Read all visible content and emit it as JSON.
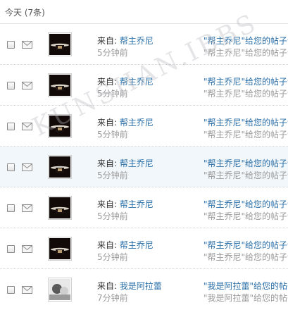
{
  "header": {
    "title": "今天 (7条)"
  },
  "messages": [
    {
      "from_prefix": "来自: ",
      "from_name": "帮主乔尼",
      "time": "5分钟前",
      "subject": "\"帮主乔尼\"给您的帖子评",
      "subject_sub": "\"帮主乔尼\"给您的帖子评"
    },
    {
      "from_prefix": "来自: ",
      "from_name": "帮主乔尼",
      "time": "5分钟前",
      "subject": "\"帮主乔尼\"给您的帖子评",
      "subject_sub": "\"帮主乔尼\"给您的帖子评"
    },
    {
      "from_prefix": "来自: ",
      "from_name": "帮主乔尼",
      "time": "5分钟前",
      "subject": "\"帮主乔尼\"给您的帖子评",
      "subject_sub": "\"帮主乔尼\"给您的帖子评"
    },
    {
      "from_prefix": "来自: ",
      "from_name": "帮主乔尼",
      "time": "5分钟前",
      "subject": "\"帮主乔尼\"给您的帖子评",
      "subject_sub": "\"帮主乔尼\"给您的帖子评"
    },
    {
      "from_prefix": "来自: ",
      "from_name": "帮主乔尼",
      "time": "5分钟前",
      "subject": "\"帮主乔尼\"给您的帖子评",
      "subject_sub": "\"帮主乔尼\"给您的帖子评"
    },
    {
      "from_prefix": "来自: ",
      "from_name": "帮主乔尼",
      "time": "5分钟前",
      "subject": "\"帮主乔尼\"给您的帖子评",
      "subject_sub": "\"帮主乔尼\"给您的帖子评"
    },
    {
      "from_prefix": "来自: ",
      "from_name": "我是阿拉蕾",
      "time": "7分钟前",
      "subject": "\"我是阿拉蕾\"给您的帖子",
      "subject_sub": "\"我是阿拉蕾\"给您的帖子"
    }
  ],
  "watermark": "KUNSHAN.IBBS",
  "colors": {
    "link": "#2a6fa8",
    "muted": "#999999",
    "highlight_row": "#f2f7fb"
  }
}
